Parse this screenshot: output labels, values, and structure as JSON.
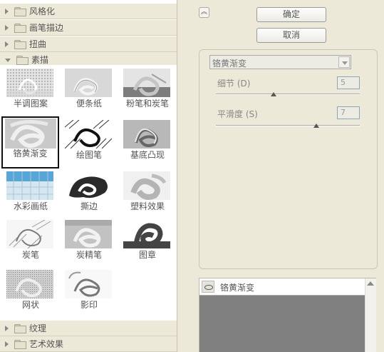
{
  "categories": {
    "style": "风格化",
    "brush": "画笔描边",
    "distort": "扭曲",
    "sketch": "素描",
    "texture": "纹理",
    "artistic": "艺术效果"
  },
  "sketch_filters": [
    "半调图案",
    "便条纸",
    "粉笔和炭笔",
    "铬黄渐变",
    "绘图笔",
    "基底凸现",
    "水彩画纸",
    "撕边",
    "塑料效果",
    "炭笔",
    "炭精笔",
    "图章",
    "网状",
    "影印"
  ],
  "selected_filter": "铬黄渐变",
  "buttons": {
    "ok": "确定",
    "cancel": "取消"
  },
  "settings": {
    "filter": "铬黄渐变",
    "detail": {
      "label": "细节 (D)",
      "value": "5",
      "level": 0.4
    },
    "smoothness": {
      "label": "平滑度 (S)",
      "value": "7",
      "level": 0.7
    }
  },
  "effect_layers": [
    {
      "name": "铬黄渐变"
    }
  ]
}
